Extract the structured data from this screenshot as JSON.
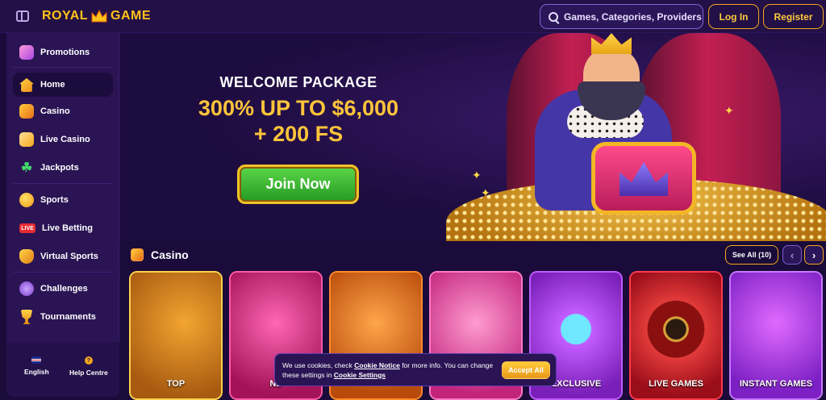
{
  "header": {
    "logo_left": "ROYAL",
    "logo_right": "GAME",
    "search_label": "Games, Categories, Providers",
    "login_label": "Log In",
    "register_label": "Register"
  },
  "sidebar": {
    "items": [
      {
        "label": "Promotions",
        "icon": "gift-icon"
      },
      {
        "label": "Home",
        "icon": "home-icon"
      },
      {
        "label": "Casino",
        "icon": "casino-icon"
      },
      {
        "label": "Live Casino",
        "icon": "cards-icon"
      },
      {
        "label": "Jackpots",
        "icon": "clover-icon"
      },
      {
        "label": "Sports",
        "icon": "ball-icon"
      },
      {
        "label": "Live Betting",
        "icon": "live-badge-icon",
        "badge": "LIVE"
      },
      {
        "label": "Virtual Sports",
        "icon": "gamepad-icon"
      },
      {
        "label": "Challenges",
        "icon": "laurel-icon"
      },
      {
        "label": "Tournaments",
        "icon": "trophy-icon"
      }
    ],
    "footer": {
      "language": "English",
      "help": "Help Centre",
      "help_glyph": "?"
    }
  },
  "hero": {
    "line1": "WELCOME PACKAGE",
    "line2": "300% UP TO $6,000",
    "line3": "+ 200 FS",
    "cta": "Join Now"
  },
  "casino": {
    "title": "Casino",
    "see_all": "See All  (10)",
    "prev": "‹",
    "next": "›",
    "cards": [
      {
        "label": "TOP"
      },
      {
        "label": "NE"
      },
      {
        "label": ""
      },
      {
        "label": ""
      },
      {
        "label": "EXCLUSIVE"
      },
      {
        "label": "LIVE GAMES"
      },
      {
        "label": "INSTANT GAMES"
      }
    ]
  },
  "cookie": {
    "text_a": "We use cookies, check ",
    "link_a": "Cookie Notice",
    "text_b": " for more info. You can change these settings in ",
    "link_b": "Cookie Settings",
    "accept": "Accept All"
  },
  "colors": {
    "accent_gold": "#ffc43a",
    "bg": "#1a0b3a",
    "sidebar_bg": "#2a1454",
    "cta_green": "#3bb534"
  }
}
